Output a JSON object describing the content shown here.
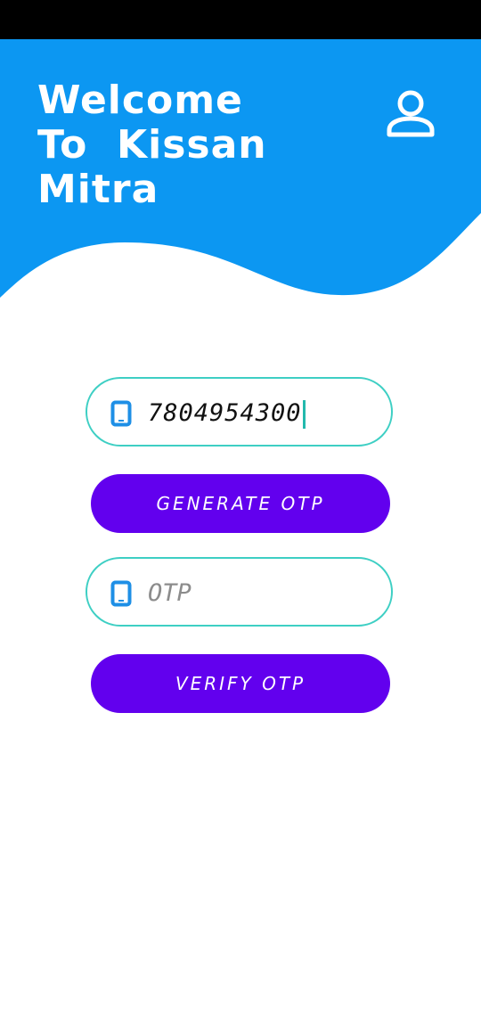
{
  "header": {
    "title_lines": [
      "Welcome",
      "To  Kissan",
      "Mitra"
    ],
    "background_color": "#0c97f2",
    "profile_icon": "person-outline-icon"
  },
  "phone_field": {
    "icon": "smartphone-icon",
    "value": "7804954300"
  },
  "generate_button": {
    "label": "GENERATE OTP",
    "color": "#6200ee"
  },
  "otp_field": {
    "icon": "smartphone-icon",
    "placeholder": "OTP",
    "value": ""
  },
  "verify_button": {
    "label": "VERIFY OTP",
    "color": "#6200ee"
  }
}
